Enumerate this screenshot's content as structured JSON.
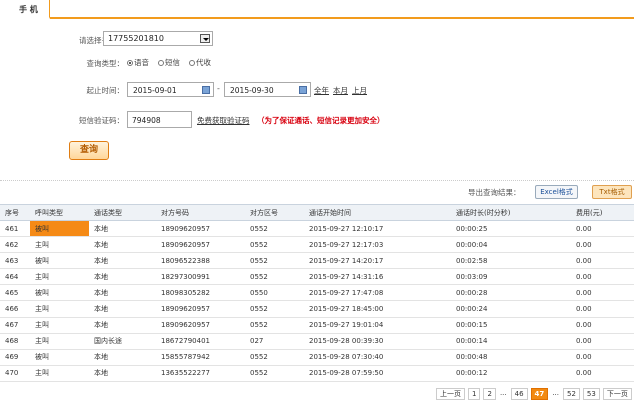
{
  "tab": {
    "label": "手 机"
  },
  "form": {
    "phone_label": "请选择号码：",
    "phone_value": "17755201810",
    "type_label": "查询类型：",
    "type_options": [
      "语音",
      "短信",
      "代收"
    ],
    "time_label": "起止时间：",
    "start_date": "2015-09-01",
    "end_date": "2015-09-30",
    "shortcut_links": [
      "全年",
      "本月",
      "上月"
    ],
    "code_label": "短信验证码：",
    "code_value": "794908",
    "get_code_link": "免费获取验证码",
    "warning": "（为了保证通话、短信记录更加安全）",
    "query_button": "查询"
  },
  "export": {
    "label": "导出查询结果：",
    "excel": "Excel格式",
    "txt": "Txt格式"
  },
  "table": {
    "headers": [
      "序号",
      "呼叫类型",
      "通话类型",
      "对方号码",
      "对方区号",
      "通话开始时间",
      "通话时长(时分秒)",
      "费用(元)"
    ],
    "rows": [
      [
        "461",
        "被叫",
        "本地",
        "18909620957",
        "0552",
        "2015-09-27 12:10:17",
        "00:00:25",
        "0.00"
      ],
      [
        "462",
        "主叫",
        "本地",
        "18909620957",
        "0552",
        "2015-09-27 12:17:03",
        "00:00:04",
        "0.00"
      ],
      [
        "463",
        "被叫",
        "本地",
        "18096522388",
        "0552",
        "2015-09-27 14:20:17",
        "00:02:58",
        "0.00"
      ],
      [
        "464",
        "主叫",
        "本地",
        "18297300991",
        "0552",
        "2015-09-27 14:31:16",
        "00:03:09",
        "0.00"
      ],
      [
        "465",
        "被叫",
        "本地",
        "18098305282",
        "0550",
        "2015-09-27 17:47:08",
        "00:00:28",
        "0.00"
      ],
      [
        "466",
        "主叫",
        "本地",
        "18909620957",
        "0552",
        "2015-09-27 18:45:00",
        "00:00:24",
        "0.00"
      ],
      [
        "467",
        "主叫",
        "本地",
        "18909620957",
        "0552",
        "2015-09-27 19:01:04",
        "00:00:15",
        "0.00"
      ],
      [
        "468",
        "主叫",
        "国内长途",
        "18672790401",
        "027",
        "2015-09-28 00:39:30",
        "00:00:14",
        "0.00"
      ],
      [
        "469",
        "被叫",
        "本地",
        "15855787942",
        "0552",
        "2015-09-28 07:30:40",
        "00:00:48",
        "0.00"
      ],
      [
        "470",
        "主叫",
        "本地",
        "13635522277",
        "0552",
        "2015-09-28 07:59:50",
        "00:00:12",
        "0.00"
      ]
    ]
  },
  "pager": {
    "prev": "上一页",
    "pages": [
      "1",
      "2",
      "...",
      "46",
      "47",
      "...",
      "52",
      "53"
    ],
    "current": "47",
    "next": "下一页"
  },
  "colors": {
    "accent": "#f29b1d",
    "highlight": "#f58a16",
    "warning": "#d8000f"
  }
}
